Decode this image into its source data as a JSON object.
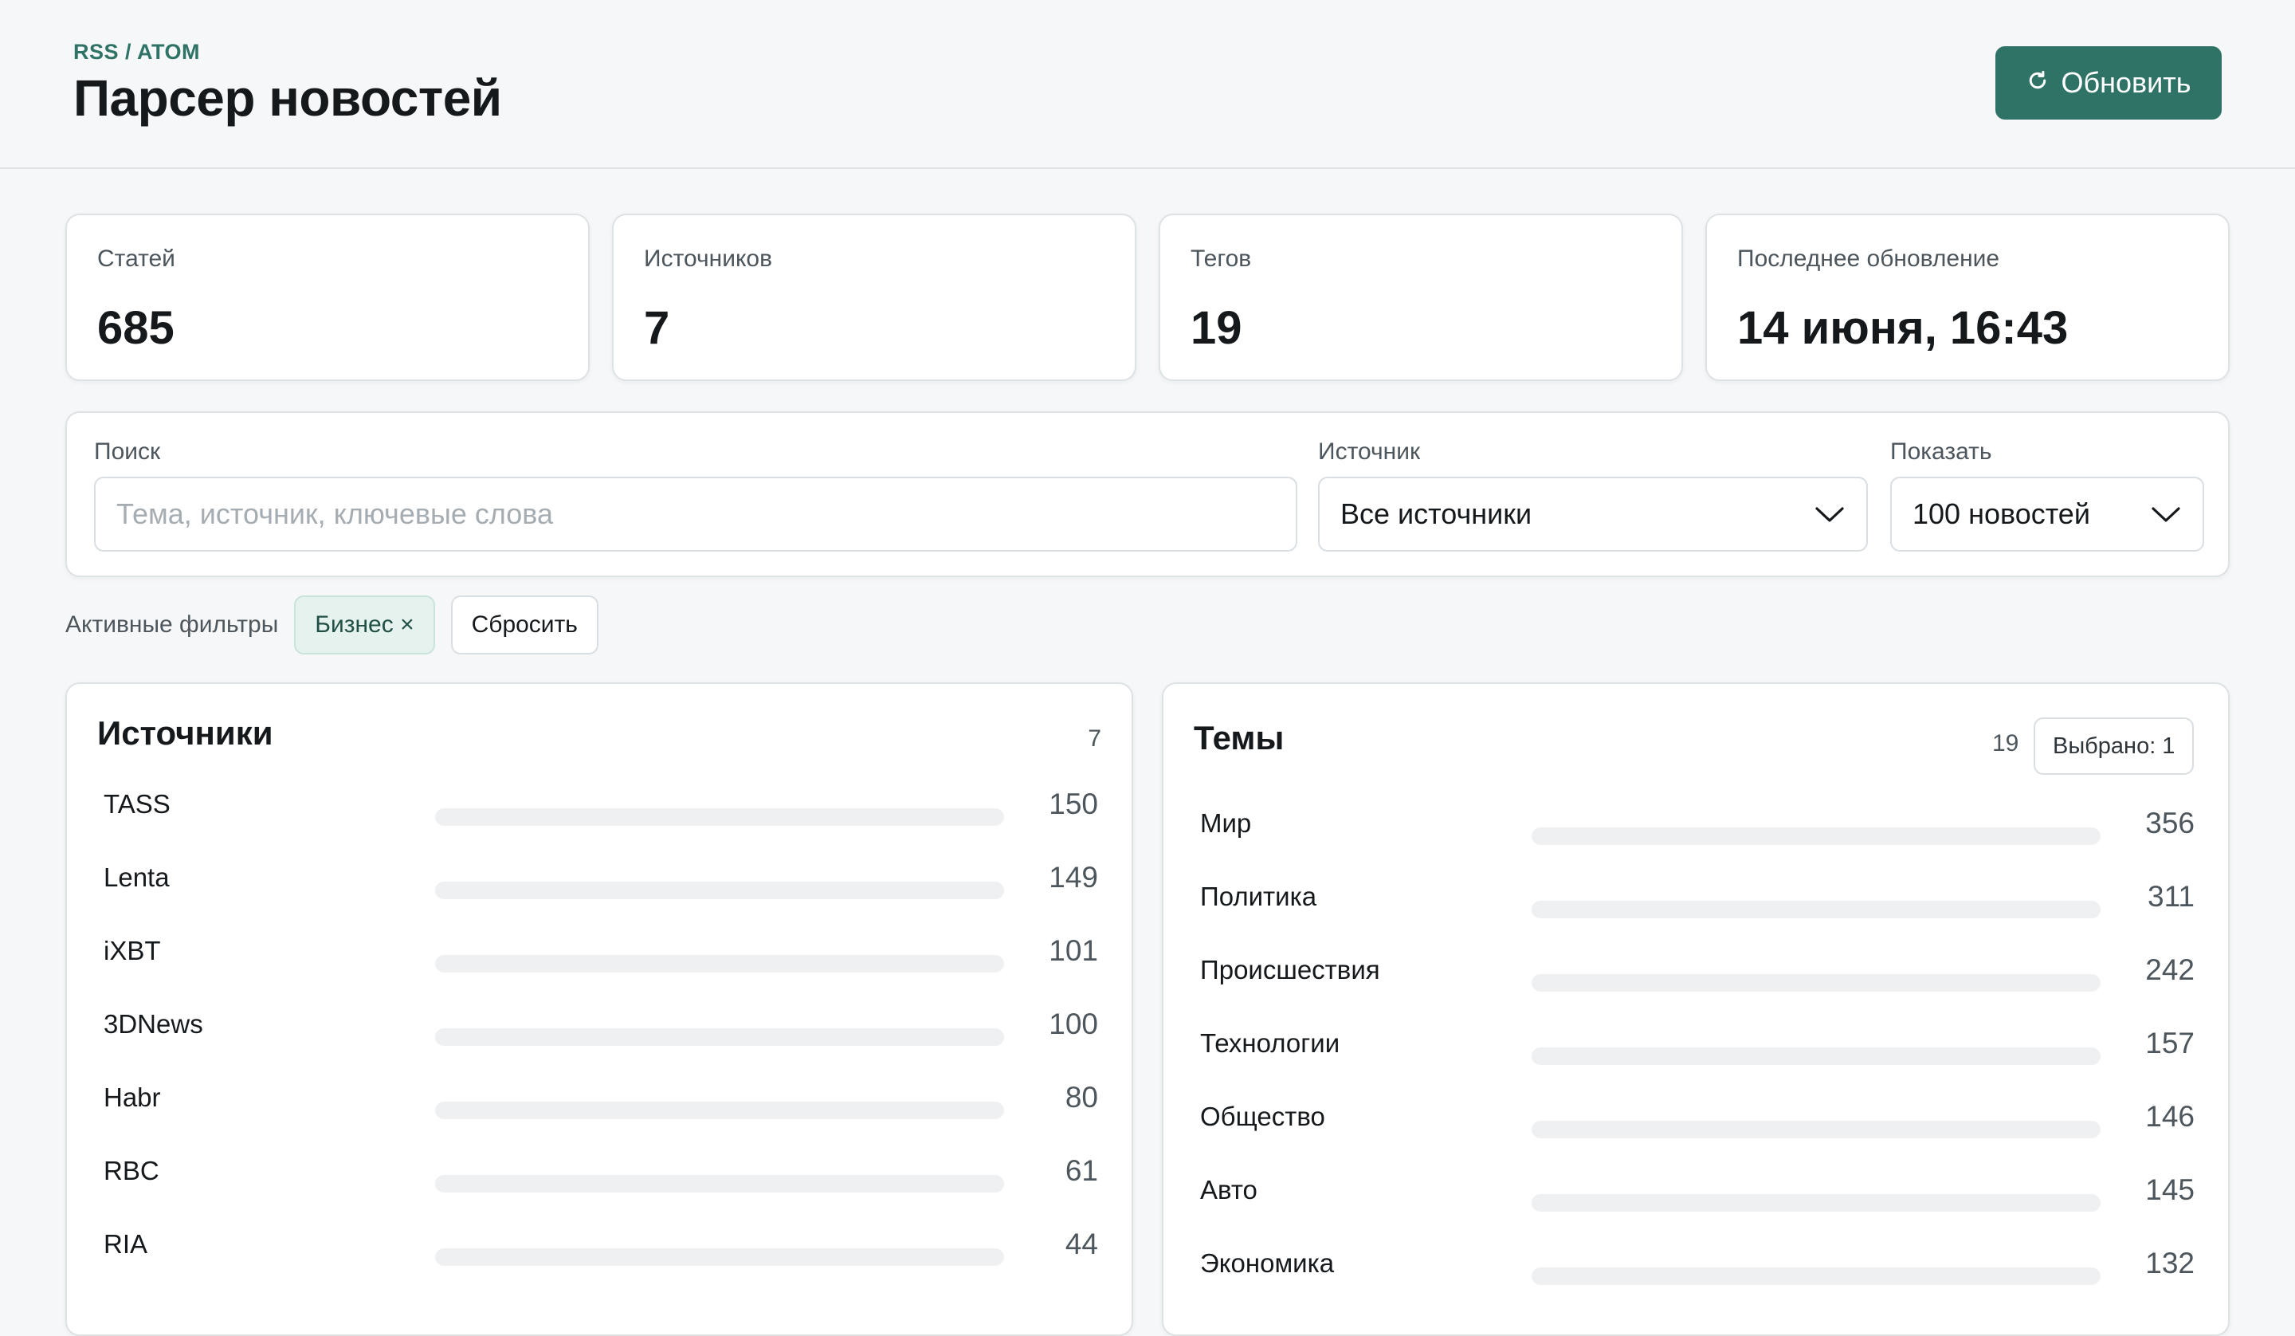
{
  "header": {
    "kicker": "RSS / ATOM",
    "title": "Парсер новостей",
    "refresh_label": "Обновить"
  },
  "stats": [
    {
      "label": "Статей",
      "value": "685"
    },
    {
      "label": "Источников",
      "value": "7"
    },
    {
      "label": "Тегов",
      "value": "19"
    },
    {
      "label": "Последнее обновление",
      "value": "14 июня, 16:43"
    }
  ],
  "filters": {
    "search_label": "Поиск",
    "search_placeholder": "Тема, источник, ключевые слова",
    "source_label": "Источник",
    "source_value": "Все источники",
    "show_label": "Показать",
    "show_value": "100 новостей"
  },
  "active_filters": {
    "label": "Активные фильтры",
    "tags": [
      "Бизнес ×"
    ],
    "reset_label": "Сбросить"
  },
  "sources_panel": {
    "title": "Источники",
    "count": "7",
    "items": [
      {
        "name": "TASS",
        "count": "150"
      },
      {
        "name": "Lenta",
        "count": "149"
      },
      {
        "name": "iXBT",
        "count": "101"
      },
      {
        "name": "3DNews",
        "count": "100"
      },
      {
        "name": "Habr",
        "count": "80"
      },
      {
        "name": "RBC",
        "count": "61"
      },
      {
        "name": "RIA",
        "count": "44"
      }
    ]
  },
  "topics_panel": {
    "title": "Темы",
    "count": "19",
    "selected_label": "Выбрано: 1",
    "items": [
      {
        "name": "Мир",
        "count": "356"
      },
      {
        "name": "Политика",
        "count": "311"
      },
      {
        "name": "Происшествия",
        "count": "242"
      },
      {
        "name": "Технологии",
        "count": "157"
      },
      {
        "name": "Общество",
        "count": "146"
      },
      {
        "name": "Авто",
        "count": "145"
      },
      {
        "name": "Экономика",
        "count": "132"
      }
    ]
  },
  "colors": {
    "accent": "#2e7366",
    "chip_bg": "#e6f2ee",
    "track": "#eef0f2"
  }
}
